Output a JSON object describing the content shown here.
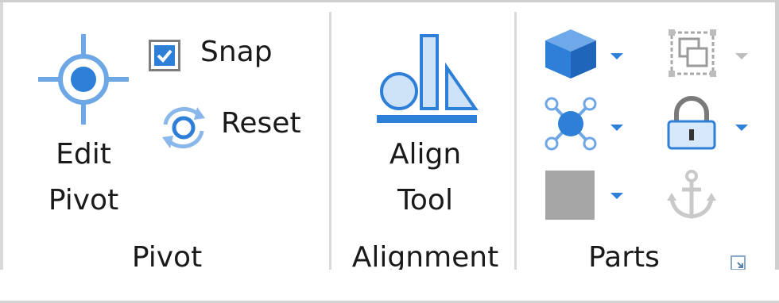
{
  "colors": {
    "accent_blue": "#2e7fd8",
    "light_blue_fill": "#cfe3f8",
    "icon_grey": "#9a9a9a",
    "separator": "#d9d9d9"
  },
  "pivot_group": {
    "edit_pivot_line1": "Edit",
    "edit_pivot_line2": "Pivot",
    "snap_label": "Snap",
    "snap_checked": true,
    "reset_label": "Reset",
    "group_label": "Pivot",
    "icons": {
      "edit_pivot": "crosshair-target-icon",
      "snap": "checkbox-checked",
      "reset": "reset-rotate-icon"
    }
  },
  "alignment_group": {
    "align_tool_line1": "Align",
    "align_tool_line2": "Tool",
    "group_label": "Alignment",
    "icons": {
      "align_tool": "align-shapes-icon"
    }
  },
  "parts_group": {
    "group_label": "Parts",
    "icons": {
      "part": "blue-cube-icon",
      "group": "ungroup-icon",
      "joint": "joint-node-icon",
      "lock": "lock-icon",
      "color": "grey-color-swatch-icon",
      "anchor": "anchor-icon",
      "dialog_launcher": "dialog-launcher-icon",
      "dropdown": "chevron-down-icon"
    }
  }
}
